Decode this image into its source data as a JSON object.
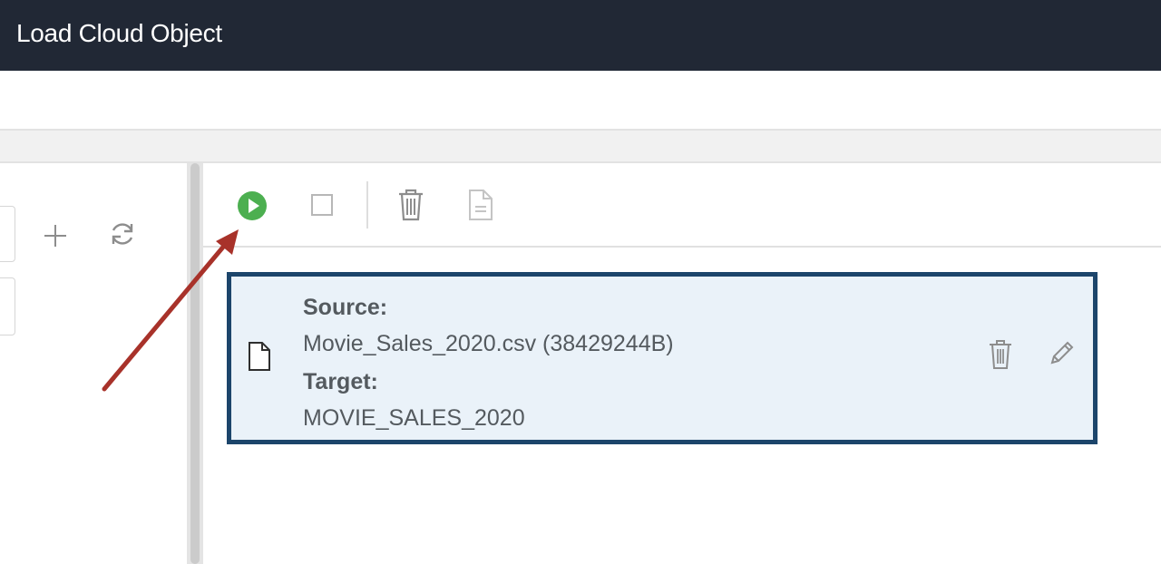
{
  "header": {
    "title": "Load Cloud Object"
  },
  "colors": {
    "header_bg": "#212835",
    "run_green": "#4caf50",
    "card_border": "#1c456b",
    "card_bg": "#eaf2f9",
    "arrow": "#a8322a"
  },
  "left_panel": {
    "icons": [
      "plus-icon",
      "refresh-icon"
    ]
  },
  "toolbar": {
    "icons": [
      "run-icon",
      "stop-icon",
      "delete-icon",
      "document-icon"
    ]
  },
  "task": {
    "source_label": "Source:",
    "source_value": "Movie_Sales_2020.csv (38429244B)",
    "target_label": "Target:",
    "target_value": "MOVIE_SALES_2020",
    "icons": [
      "file-icon",
      "delete-icon",
      "edit-icon"
    ]
  }
}
